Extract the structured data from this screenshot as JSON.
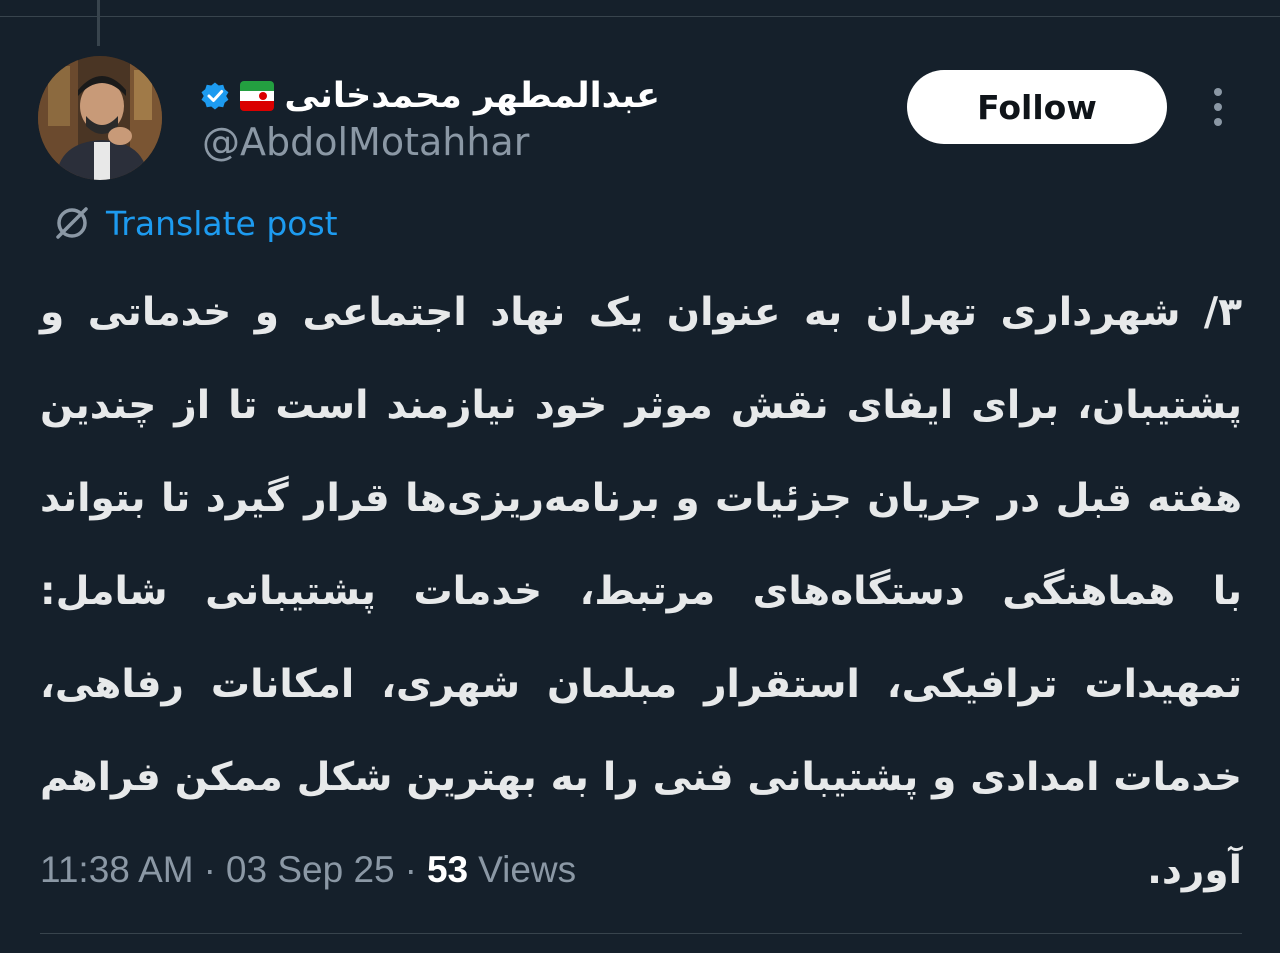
{
  "author": {
    "display_name": "عبدالمطهر محمدخانی",
    "handle": "@AbdolMotahhar",
    "flag_icon": "iran-flag-icon",
    "verified_icon": "verified-badge-icon"
  },
  "actions": {
    "follow_label": "Follow",
    "more_icon": "more-vertical-icon"
  },
  "translate": {
    "label": "Translate post",
    "icon": "translate-globe-icon"
  },
  "post": {
    "text": "۳/ شهرداری تهران به عنوان یک نهاد اجتماعی و خدماتی و پشتیبان، برای ایفای نقش موثر خود نیازمند است تا از چندین هفته قبل در جریان جزئیات و برنامه‌ریزی‌ها قرار گیرد تا بتواند با هماهنگی دستگاه‌های مرتبط، خدمات پشتیبانی شامل: تمهیدات ترافیکی، استقرار مبلمان شهری، امکانات رفاهی، خدمات امدادی و پشتیبانی فنی را به بهترین شکل ممکن فراهم آورد."
  },
  "meta": {
    "time": "11:38 AM",
    "separator": "·",
    "date": "03 Sep 25",
    "views_count": "53",
    "views_label": "Views"
  },
  "colors": {
    "background": "#15202b",
    "accent": "#1d9bf0",
    "muted": "#8b98a5",
    "divider": "#38444d"
  }
}
